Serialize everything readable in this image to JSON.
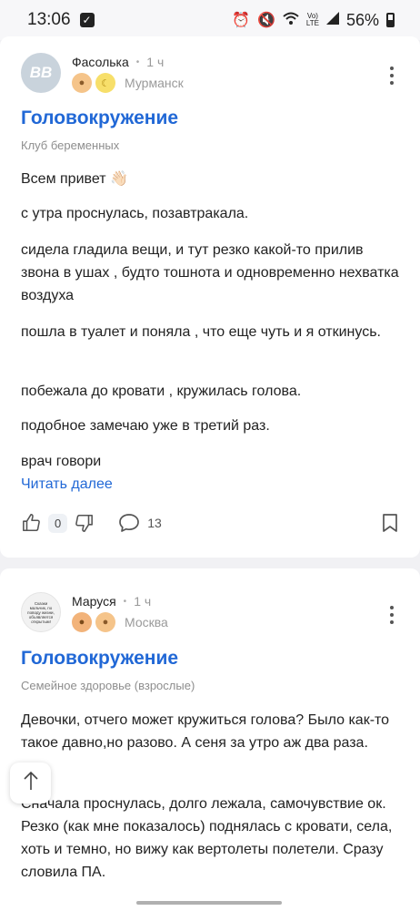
{
  "status_bar": {
    "time": "13:06",
    "battery": "56%"
  },
  "posts": [
    {
      "author": "Фасолька",
      "time_ago": "1 ч",
      "avatar_text": "BB",
      "city": "Мурманск",
      "title": "Головокружение",
      "club": "Клуб беременных",
      "paragraphs": [
        "Всем привет 👋🏻",
        "с утра проснулась, позавтракала.",
        "сидела гладила вещи, и тут резко какой-то прилив звона в ушах , будто тошнота и одновременно нехватка воздуха",
        "пошла в туалет и поняла , что еще чуть и я откинусь.",
        "побежала до кровати , кружилась голова.",
        "подобное замечаю уже в третий раз.",
        "врач говори"
      ],
      "read_more": "Читать далее",
      "likes": "0",
      "comments": "13"
    },
    {
      "author": "Маруся",
      "time_ago": "1 ч",
      "avatar_text": "Сказки мальчик, по поводу жизни, объявляется открытым!",
      "city": "Москва",
      "title": "Головокружение",
      "club": "Семейное здоровье (взрослые)",
      "paragraphs": [
        "Девочки, отчего может кружиться голова? Было как-то такое давно,но разово. А сеня за утро аж два раза.",
        "Сначала проснулась, долго лежала, самочувствие ок. Резко (как мне показалось) поднялась с кровати, села, хоть и темно, но вижу как вертолеты полетели. Сразу словила ПА."
      ]
    }
  ]
}
